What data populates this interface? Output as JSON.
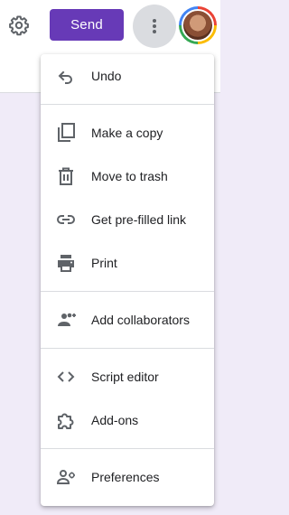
{
  "header": {
    "send_label": "Send",
    "accent_color": "#673ab7"
  },
  "menu": {
    "items": [
      {
        "label": "Undo",
        "icon": "undo-icon"
      },
      {
        "label": "Make a copy",
        "icon": "copy-icon"
      },
      {
        "label": "Move to trash",
        "icon": "trash-icon"
      },
      {
        "label": "Get pre-filled link",
        "icon": "link-icon"
      },
      {
        "label": "Print",
        "icon": "print-icon"
      },
      {
        "label": "Add collaborators",
        "icon": "add-collaborators-icon"
      },
      {
        "label": "Script editor",
        "icon": "code-icon"
      },
      {
        "label": "Add-ons",
        "icon": "puzzle-icon"
      },
      {
        "label": "Preferences",
        "icon": "preferences-icon"
      }
    ]
  }
}
